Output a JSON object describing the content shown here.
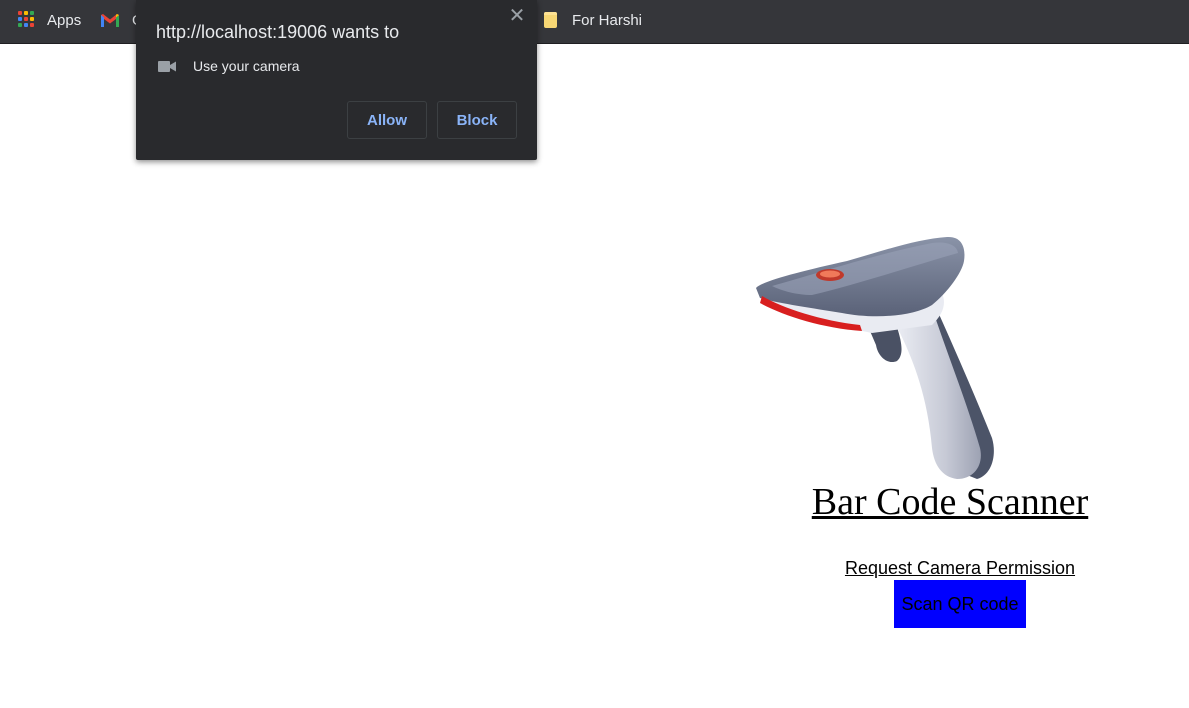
{
  "bookmarks": {
    "apps_label": "Apps",
    "gmail_label": "G",
    "folder_label": "For Harshi"
  },
  "permission_popup": {
    "title": "http://localhost:19006 wants to",
    "close_glyph": "✕",
    "camera_label": "Use your camera",
    "allow_label": "Allow",
    "block_label": "Block",
    "button_text_color": "#8ab4f8",
    "background": "#292a2d"
  },
  "page": {
    "title": "Bar Code Scanner",
    "request_link": "Request Camera Permission",
    "scan_button": "Scan QR code",
    "scan_button_color": "#0000ff",
    "scanner_image": "barcode-scanner-image"
  }
}
